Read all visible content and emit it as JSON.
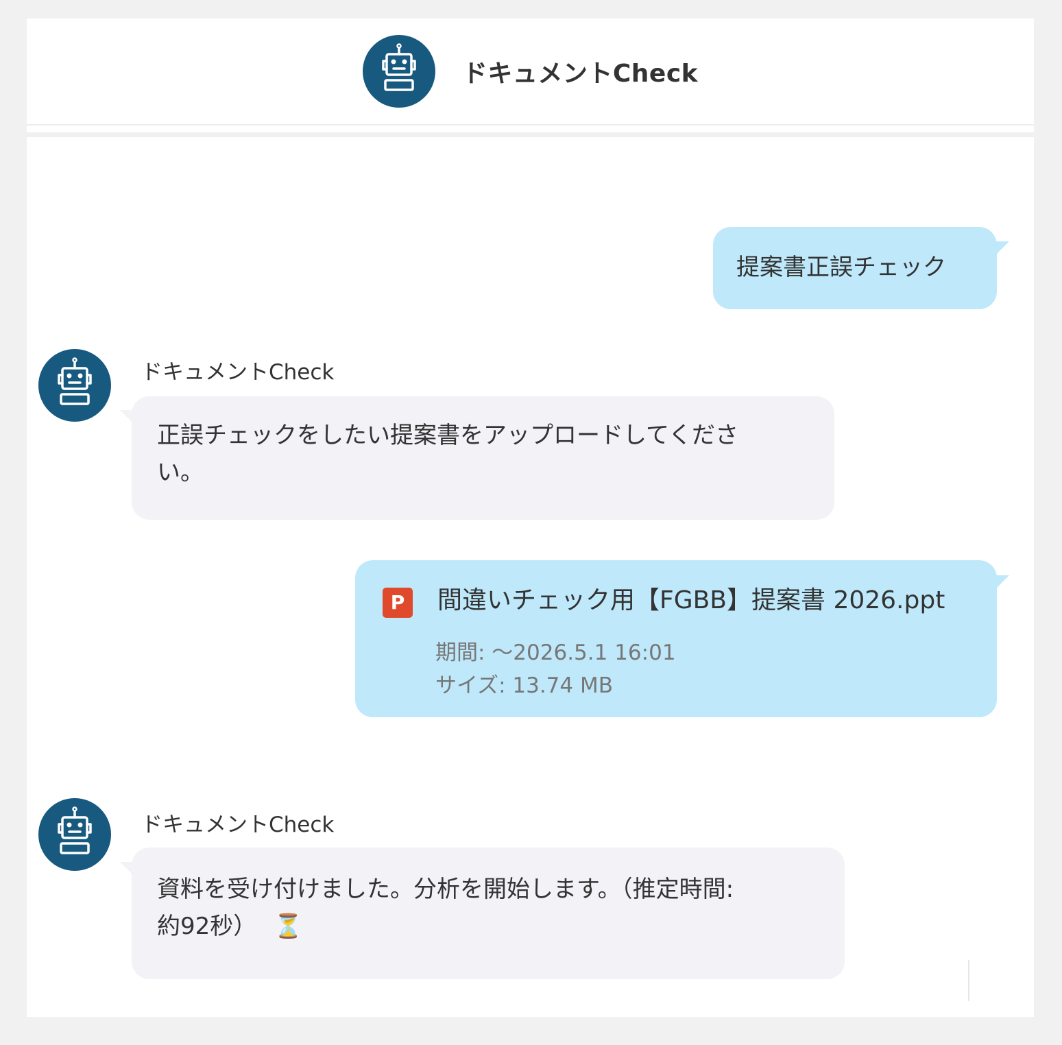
{
  "app": {
    "title": "ドキュメントCheck",
    "avatar_icon": "robot-icon",
    "brand_color": "#17597f"
  },
  "messages": [
    {
      "role": "user",
      "text": "提案書正誤チェック"
    },
    {
      "role": "bot",
      "sender": "ドキュメントCheck",
      "text_line1": "正誤チェックをしたい提案書をアップロードしてくださ",
      "text_line2": "い。"
    },
    {
      "role": "user",
      "type": "file",
      "file_icon": "powerpoint-file-icon",
      "file_badge": "P",
      "file_name": "間違いチェック用【FGBB】提案書 2026.ppt",
      "expiry": "期間: ～2026.5.1 16:01",
      "size": "サイズ: 13.74 MB"
    },
    {
      "role": "bot",
      "sender": "ドキュメントCheck",
      "text_line1": "資料を受け付けました。分析を開始します。（推定時間:",
      "text_line2": "約92秒）",
      "emoji": "⏳"
    }
  ]
}
